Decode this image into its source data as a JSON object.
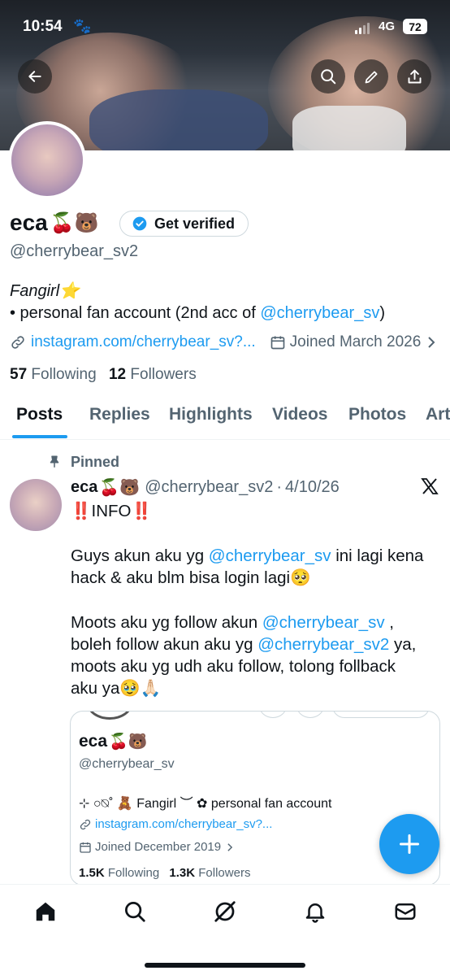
{
  "status": {
    "time": "10:54",
    "network": "4G",
    "battery": "72"
  },
  "profile": {
    "name": "eca",
    "name_emoji": "🍒🐻",
    "get_verified_label": "Get verified",
    "handle": "@cherrybear_sv2",
    "bio_line1": "Fangirl⭐",
    "bio_line2_prefix": "• personal fan account (2nd acc of ",
    "bio_line2_mention": "@cherrybear_sv",
    "bio_line2_suffix": ")",
    "website": "instagram.com/cherrybear_sv?...",
    "joined": "Joined March 2026",
    "following_count": "57",
    "following_label": "Following",
    "followers_count": "12",
    "followers_label": "Followers"
  },
  "tabs": [
    {
      "label": "Posts",
      "active": true
    },
    {
      "label": "Replies"
    },
    {
      "label": "Highlights"
    },
    {
      "label": "Videos"
    },
    {
      "label": "Photos"
    },
    {
      "label": "Art"
    }
  ],
  "post": {
    "pinned_label": "Pinned",
    "author_name": "eca",
    "author_emoji": "🍒🐻",
    "author_handle": "@cherrybear_sv2",
    "separator": "·",
    "date": "4/10/26",
    "line_info": "‼️INFO‼️",
    "p2_prefix": "Guys akun aku yg ",
    "p2_mention": "@cherrybear_sv",
    "p2_suffix_a": " ini lagi kena",
    "p2_line2": "hack & aku blm bisa login lagi🥺",
    "p3_prefix": "Moots aku yg follow akun ",
    "p3_mention1": "@cherrybear_sv",
    "p3_mid1": " ,",
    "p3_l2_prefix": "boleh follow akun aku yg ",
    "p3_mention2": "@cherrybear_sv2",
    "p3_l2_suffix": " ya,",
    "p3_line3": "moots aku yg udh aku follow, tolong follback",
    "p3_line4": "aku ya🥹🙏🏻"
  },
  "embedded": {
    "name": "eca",
    "name_emoji": "🍒🐻",
    "handle": "@cherrybear_sv",
    "bio": "⊹ ○⍉˚ 🧸 Fangirl ︶ ✿ personal fan account",
    "website": "instagram.com/cherrybear_sv?...",
    "joined": "Joined December 2019",
    "following_count": "1.5K",
    "following_label": "Following",
    "followers_count": "1.3K",
    "followers_label": "Followers"
  },
  "colors": {
    "accent": "#1d9bf0",
    "text": "#0f1419",
    "muted": "#536471",
    "alert": "#e0245e"
  },
  "icons": {
    "back": "arrow-left-icon",
    "search": "search-icon",
    "edit": "pencil-icon",
    "share": "share-icon",
    "verified": "verified-badge-icon",
    "link": "link-icon",
    "calendar": "calendar-icon",
    "pin": "pin-icon",
    "x_logo": "x-logo-icon",
    "compose": "plus-icon",
    "nav": [
      "home-icon",
      "search-icon",
      "grok-icon",
      "bell-icon",
      "mail-icon"
    ]
  }
}
